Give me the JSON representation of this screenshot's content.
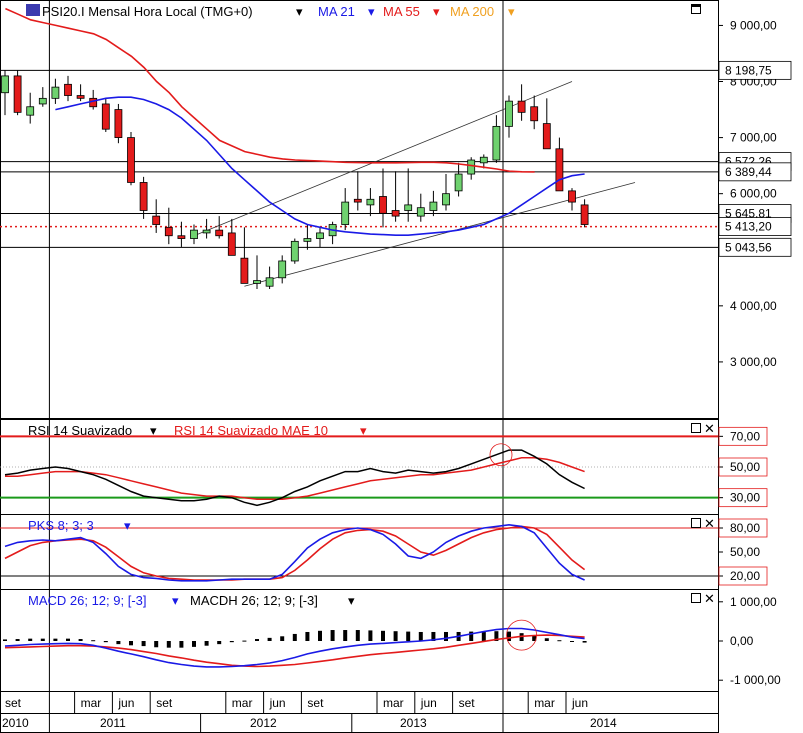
{
  "colors": {
    "up": "#6fd26f",
    "down": "#e31b1b",
    "ma21": "#1a1ae6",
    "ma55": "#e31b1b",
    "ma200": "#f0a020",
    "rsi": "#000000",
    "rsi_ma": "#e31b1b",
    "pks_k": "#1a1ae6",
    "pks_d": "#e31b1b",
    "macd": "#1a1ae6",
    "macd_signal": "#e31b1b",
    "band_high": "#e31b1b",
    "band_low": "#1a9a1a",
    "axis": "#000000"
  },
  "panels": {
    "price": {
      "title": "PSI20.I Mensal Hora Local (TMG+0)",
      "legend": [
        {
          "label": "MA 21",
          "color": "#1a1ae6"
        },
        {
          "label": "MA 55",
          "color": "#e31b1b"
        },
        {
          "label": "MA 200",
          "color": "#f0a020"
        }
      ],
      "y_ticks": [
        "9 000,00",
        "8 000,00",
        "7 000,00",
        "6 000,00",
        "5 000,00",
        "4 000,00",
        "3 000,00"
      ],
      "y_tick_values": [
        9000,
        8000,
        7000,
        6000,
        5000,
        4000,
        3000
      ],
      "price_labels": [
        {
          "text": "8 198,75",
          "value": 8198.75
        },
        {
          "text": "6 572,26",
          "value": 6572.26
        },
        {
          "text": "6 389,44",
          "value": 6389.44
        },
        {
          "text": "5 645,81",
          "value": 5645.81
        },
        {
          "text": "5 413,20",
          "value": 5413.2
        },
        {
          "text": "5 043,56",
          "value": 5043.56
        }
      ],
      "ylim": [
        2000,
        9400
      ]
    },
    "rsi": {
      "title": "RSI 14 Suavizado",
      "title2": "RSI 14 Suavizado MAE 10",
      "y_ticks": [
        "70,00",
        "50,00",
        "30,00"
      ],
      "y_tick_values": [
        70,
        50,
        30
      ],
      "ylim": [
        20,
        80
      ]
    },
    "pks": {
      "title": "PKS 8; 3; 3",
      "y_ticks": [
        "80,00",
        "50,00",
        "20,00"
      ],
      "y_tick_values": [
        80,
        50,
        20
      ],
      "ylim": [
        5,
        95
      ]
    },
    "macd": {
      "title": "MACD 26; 12; 9; [-3]",
      "title2": "MACDH 26; 12; 9; [-3]",
      "y_ticks": [
        "1 000,00",
        "0,00",
        "-1 000,00"
      ],
      "y_tick_values": [
        1000,
        0,
        -1000
      ],
      "ylim": [
        -1250,
        1250
      ]
    }
  },
  "x_axis": {
    "months": [
      "set",
      "mar",
      "jun",
      "set",
      "mar",
      "jun",
      "set",
      "mar",
      "jun",
      "set",
      "mar",
      "jun"
    ],
    "years": [
      "2010",
      "2011",
      "2012",
      "2013",
      "2014"
    ]
  },
  "chart_data": {
    "type": "candlestick",
    "x": [
      "2010-09",
      "2010-10",
      "2010-11",
      "2010-12",
      "2011-01",
      "2011-02",
      "2011-03",
      "2011-04",
      "2011-05",
      "2011-06",
      "2011-07",
      "2011-08",
      "2011-09",
      "2011-10",
      "2011-11",
      "2011-12",
      "2012-01",
      "2012-02",
      "2012-03",
      "2012-04",
      "2012-05",
      "2012-06",
      "2012-07",
      "2012-08",
      "2012-09",
      "2012-10",
      "2012-11",
      "2012-12",
      "2013-01",
      "2013-02",
      "2013-03",
      "2013-04",
      "2013-05",
      "2013-06",
      "2013-07",
      "2013-08",
      "2013-09",
      "2013-10",
      "2013-11",
      "2013-12",
      "2014-01",
      "2014-02",
      "2014-03",
      "2014-04",
      "2014-05",
      "2014-06",
      "2014-07"
    ],
    "open": [
      7800,
      8100,
      7400,
      7600,
      7700,
      7950,
      7750,
      7700,
      7600,
      7500,
      7000,
      6200,
      5600,
      5400,
      5250,
      5200,
      5300,
      5350,
      5300,
      4850,
      4400,
      4350,
      4500,
      4800,
      5150,
      5200,
      5250,
      5450,
      5900,
      5800,
      5950,
      5700,
      5700,
      5600,
      5700,
      5800,
      6050,
      6350,
      6550,
      6600,
      7200,
      7650,
      7550,
      7250,
      6800,
      6050,
      5800
    ],
    "high": [
      8200,
      8200,
      7800,
      7900,
      8050,
      8100,
      7950,
      7850,
      7700,
      7600,
      7100,
      6300,
      5900,
      5750,
      5500,
      5450,
      5550,
      5600,
      5550,
      5400,
      4900,
      4700,
      4900,
      5200,
      5450,
      5400,
      5500,
      6100,
      6400,
      6100,
      6450,
      6400,
      6450,
      6000,
      6050,
      6350,
      6550,
      6650,
      6700,
      7400,
      7750,
      7950,
      7750,
      7700,
      7000,
      6100,
      5900
    ],
    "low": [
      7400,
      7400,
      7250,
      7550,
      7600,
      7650,
      7650,
      7500,
      7100,
      6900,
      6150,
      5550,
      5300,
      5100,
      5050,
      5100,
      5200,
      5200,
      5150,
      4600,
      4300,
      4300,
      4400,
      4750,
      5000,
      5050,
      5100,
      5350,
      5700,
      5600,
      5400,
      5500,
      5500,
      5500,
      5600,
      5700,
      5950,
      6250,
      6450,
      6550,
      7000,
      7300,
      7150,
      6800,
      6050,
      5700,
      5400
    ],
    "close": [
      8100,
      7450,
      7550,
      7700,
      7900,
      7750,
      7700,
      7550,
      7150,
      7000,
      6200,
      5700,
      5450,
      5250,
      5200,
      5350,
      5350,
      5250,
      4900,
      4400,
      4450,
      4500,
      4800,
      5150,
      5200,
      5300,
      5450,
      5850,
      5850,
      5900,
      5650,
      5600,
      5800,
      5750,
      5850,
      6000,
      6350,
      6600,
      6650,
      7200,
      7650,
      7450,
      7300,
      6800,
      6050,
      5850,
      5450
    ],
    "ma21": [
      7500,
      7550,
      7600,
      7650,
      7700,
      7720,
      7720,
      7680,
      7600,
      7500,
      7350,
      7150,
      6950,
      6700,
      6450,
      6250,
      6050,
      5850,
      5700,
      5550,
      5450,
      5400,
      5350,
      5320,
      5300,
      5280,
      5270,
      5260,
      5260,
      5280,
      5300,
      5320,
      5350,
      5400,
      5450,
      5550,
      5650,
      5800,
      5950,
      6100,
      6250,
      6320,
      6350
    ],
    "ma55": [
      9300,
      9200,
      9100,
      9050,
      9000,
      8950,
      8900,
      8850,
      8750,
      8600,
      8450,
      8250,
      8000,
      7800,
      7550,
      7350,
      7150,
      6950,
      6850,
      6750,
      6700,
      6650,
      6620,
      6600,
      6590,
      6580,
      6570,
      6560,
      6555,
      6550,
      6550,
      6550,
      6555,
      6560,
      6560,
      6550,
      6530,
      6500,
      6470,
      6440,
      6400,
      6390,
      6389
    ],
    "rsi": [
      45,
      46,
      48,
      49,
      50,
      49,
      47,
      45,
      42,
      38,
      34,
      31,
      30,
      29,
      28,
      28,
      29,
      31,
      30,
      27,
      25,
      27,
      30,
      34,
      37,
      41,
      44,
      47,
      47,
      49,
      47,
      46,
      48,
      47,
      46,
      47,
      49,
      52,
      55,
      58,
      61,
      61,
      57,
      52,
      45,
      40,
      36
    ],
    "rsi_ma": [
      44,
      44,
      45,
      46,
      47,
      47,
      47,
      46,
      45,
      43,
      41,
      39,
      37,
      35,
      33,
      32,
      31,
      31,
      31,
      30,
      29,
      29,
      29,
      30,
      31,
      33,
      35,
      37,
      39,
      41,
      42,
      43,
      44,
      45,
      45,
      46,
      47,
      48,
      50,
      52,
      54,
      56,
      56,
      55,
      53,
      50,
      47
    ],
    "pks_k": [
      57,
      62,
      64,
      65,
      64,
      66,
      68,
      62,
      48,
      32,
      22,
      18,
      17,
      15,
      14,
      14,
      14,
      15,
      16,
      16,
      16,
      16,
      22,
      38,
      55,
      66,
      74,
      78,
      80,
      78,
      72,
      60,
      45,
      42,
      50,
      62,
      70,
      76,
      80,
      82,
      84,
      82,
      74,
      55,
      36,
      22,
      15
    ],
    "pks_d": [
      42,
      50,
      58,
      62,
      64,
      65,
      66,
      64,
      56,
      44,
      32,
      24,
      20,
      17,
      16,
      15,
      15,
      15,
      15,
      16,
      16,
      16,
      18,
      27,
      40,
      54,
      66,
      74,
      77,
      78,
      76,
      70,
      60,
      50,
      46,
      52,
      60,
      68,
      74,
      78,
      80,
      82,
      80,
      72,
      56,
      40,
      28
    ],
    "macd": [
      -130,
      -110,
      -90,
      -80,
      -70,
      -60,
      -70,
      -110,
      -180,
      -260,
      -330,
      -400,
      -480,
      -550,
      -600,
      -640,
      -660,
      -660,
      -650,
      -630,
      -600,
      -560,
      -500,
      -420,
      -330,
      -260,
      -200,
      -150,
      -110,
      -80,
      -60,
      -40,
      -20,
      0,
      30,
      70,
      120,
      180,
      240,
      290,
      320,
      320,
      280,
      220,
      160,
      100,
      60
    ],
    "macd_signal": [
      -170,
      -160,
      -150,
      -140,
      -130,
      -120,
      -120,
      -130,
      -150,
      -180,
      -220,
      -270,
      -320,
      -380,
      -430,
      -490,
      -540,
      -580,
      -620,
      -640,
      -650,
      -640,
      -620,
      -600,
      -560,
      -520,
      -480,
      -430,
      -390,
      -350,
      -320,
      -290,
      -260,
      -230,
      -200,
      -160,
      -110,
      -60,
      -10,
      40,
      80,
      120,
      140,
      150,
      140,
      120,
      100
    ],
    "macdh": [
      40,
      50,
      60,
      60,
      60,
      60,
      50,
      20,
      -30,
      -80,
      -110,
      -130,
      -160,
      -170,
      -170,
      -150,
      -120,
      -80,
      -30,
      10,
      50,
      80,
      120,
      180,
      230,
      260,
      280,
      280,
      280,
      270,
      260,
      250,
      240,
      230,
      230,
      230,
      230,
      240,
      250,
      250,
      240,
      200,
      140,
      70,
      20,
      -20,
      -40
    ]
  }
}
